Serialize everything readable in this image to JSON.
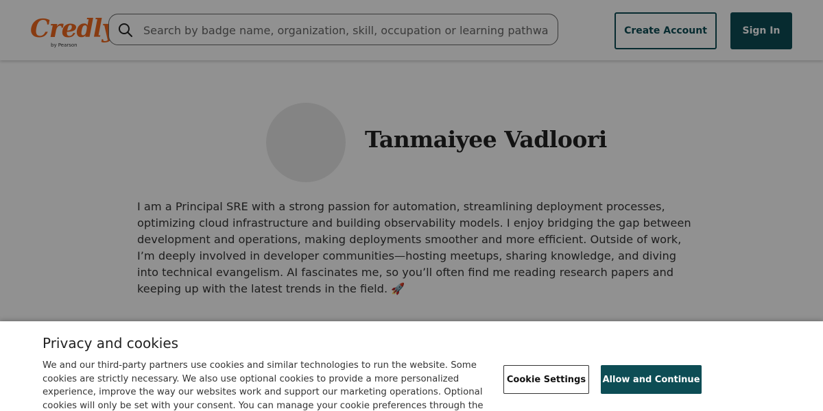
{
  "header": {
    "logo": {
      "name": "Credly",
      "sub": "by Pearson"
    },
    "search": {
      "placeholder": "Search by badge name, organization, skill, occupation or learning pathway",
      "value": ""
    },
    "create_account_label": "Create Account",
    "sign_in_label": "Sign In"
  },
  "profile": {
    "name": "Tanmaiyee Vadloori",
    "bio": "I am a Principal SRE with a strong passion for automation, streamlining deployment processes, optimizing cloud infrastructure and building observability models. I enjoy bridging the gap between development and operations, making deployments smoother and more efficient. Outside of work, I’m deeply involved in developer communities—hosting meetups, sharing knowledge, and diving into technical evangelism. AI fascinates me, so you’ll often find me reading research papers and keeping up with the latest trends in the field. 🚀"
  },
  "cookie_banner": {
    "title": "Privacy and cookies",
    "text": "We and our third-party partners use cookies and similar technologies to run the website. Some cookies are strictly necessary. We also use optional cookies to provide a more personalized experience, improve the way our websites work and support our marketing operations. Optional cookies will only be set with your consent. You can manage your cookie preferences through the \"Cookie Settings\" button. For more information see",
    "settings_label": "Cookie Settings",
    "allow_label": "Allow and Continue"
  },
  "colors": {
    "brand": "#f0691e",
    "primary": "#0d4d55"
  }
}
